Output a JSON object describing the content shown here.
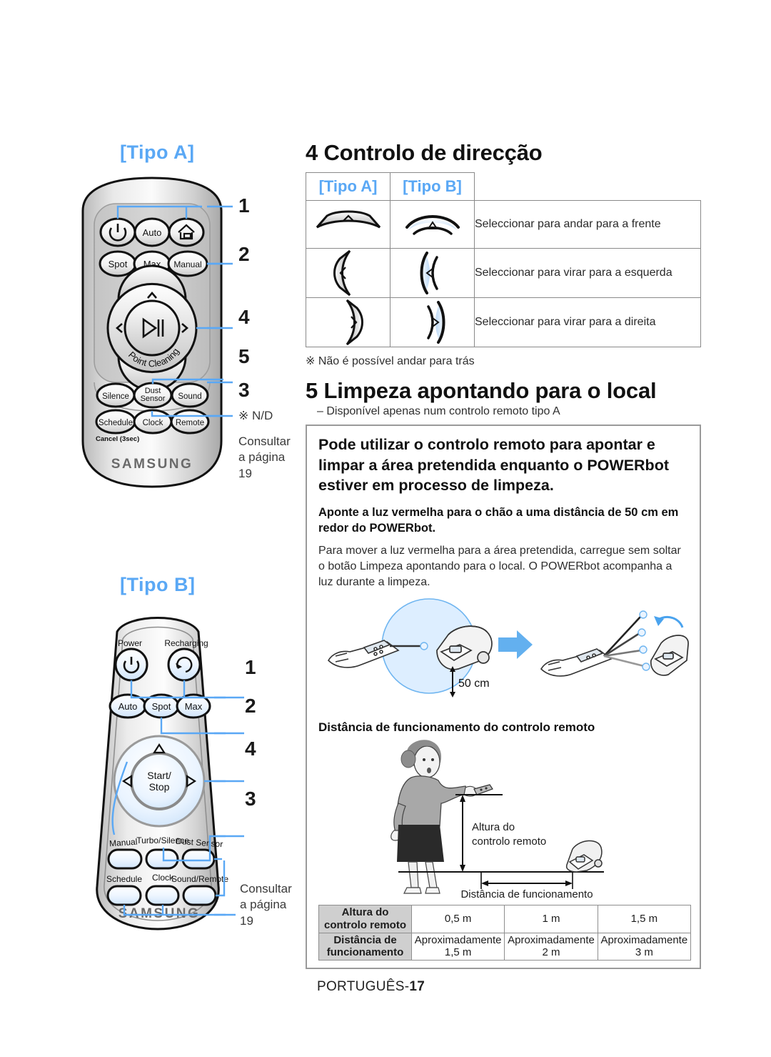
{
  "page": {
    "footer_label": "PORTUGUÊS-",
    "footer_number": "17"
  },
  "left": {
    "type_a_label": "[Tipo A]",
    "type_b_label": "[Tipo B]",
    "brand": "SAMSUNG",
    "type_a": {
      "callouts": [
        "1",
        "2",
        "4",
        "5",
        "3"
      ],
      "note_nd": "※ N/D",
      "note_page": "Consultar a página 19",
      "buttons": {
        "power_icon": "power-icon",
        "auto": "Auto",
        "home_icon": "home-dock-icon",
        "spot": "Spot",
        "max": "Max",
        "manual": "Manual",
        "up_icon": "chevron-up-icon",
        "left_icon": "chevron-left-icon",
        "right_icon": "chevron-right-icon",
        "center_icon": "play-pause-icon",
        "point_cleaning": "Point Cleaning",
        "silence": "Silence",
        "dust_sensor": "Dust Sensor",
        "sound": "Sound",
        "schedule": "Schedule",
        "clock": "Clock",
        "remote": "Remote",
        "cancel_sub": "Cancel (3sec)"
      }
    },
    "type_b": {
      "callouts": [
        "1",
        "2",
        "4",
        "3"
      ],
      "note_page": "Consultar a página 19",
      "buttons": {
        "power_label": "Power",
        "recharging_label": "Recharging",
        "power_icon": "power-icon",
        "recharging_icon": "recharge-icon",
        "auto": "Auto",
        "spot": "Spot",
        "max": "Max",
        "up_icon": "triangle-up-icon",
        "left_icon": "triangle-left-icon",
        "right_icon": "triangle-right-icon",
        "start_stop": "Start/\nStop",
        "start_stop_line1": "Start/",
        "start_stop_line2": "Stop",
        "manual": "Manual",
        "turbo_silence": "Turbo/Silence",
        "dust_sensor": "Dust Sensor",
        "schedule": "Schedule",
        "clock": "Clock",
        "sound_remote": "Sound/Remote"
      }
    }
  },
  "right": {
    "section4": {
      "heading": "4 Controlo de direcção",
      "table": {
        "headers": [
          "[Tipo A]",
          "[Tipo B]",
          ""
        ],
        "rows": [
          {
            "icon_a": "arc-up-icon",
            "icon_b": "arc-up-blue-icon",
            "description": "Seleccionar para andar para a frente"
          },
          {
            "icon_a": "arc-left-icon",
            "icon_b": "arc-left-blue-icon",
            "description": "Seleccionar para virar para a esquerda"
          },
          {
            "icon_a": "arc-right-icon",
            "icon_b": "arc-right-blue-icon",
            "description": "Seleccionar para virar para a direita"
          }
        ]
      },
      "note": "※ Não é possível andar para trás"
    },
    "section5": {
      "heading": "5 Limpeza apontando para o local",
      "subnote": "– Disponível apenas num controlo remoto tipo A",
      "lead": "Pode utilizar o controlo remoto para apontar e limpar a área pretendida enquanto o POWERbot estiver em processo de limpeza.",
      "strong": "Aponte a luz vermelha para o chão a uma distância de 50 cm em redor do POWERbot.",
      "body": "Para mover a luz vermelha para a área pretendida, carregue sem soltar o botão Limpeza apontando para o local. O POWERbot acompanha a luz durante a limpeza.",
      "figure1": {
        "distance_label": "50 cm",
        "arrow_icon": "right-arrow-icon",
        "robot_icon": "robot-vacuum-icon",
        "remote_icon": "hand-holding-remote-icon"
      },
      "figure2_caption": "Distância de funcionamento do controlo remoto",
      "figure2": {
        "height_label_line1": "Altura do",
        "height_label_line2": "controlo remoto",
        "distance_label": "Distância de funcionamento",
        "person_icon": "person-with-remote-icon",
        "robot_icon": "robot-vacuum-icon"
      },
      "dist_table": {
        "row1_header_line1": "Altura do",
        "row1_header_line2": "controlo remoto",
        "row1_values": [
          "0,5 m",
          "1 m",
          "1,5 m"
        ],
        "row2_header_line1": "Distância de",
        "row2_header_line2": "funcionamento",
        "row2_values": [
          "Aproximadamente 1,5 m",
          "Aproximadamente 2 m",
          "Aproximadamente 3 m"
        ],
        "row2_values_split": [
          {
            "l1": "Aproximadamente",
            "l2": "1,5 m"
          },
          {
            "l1": "Aproximadamente",
            "l2": "2 m"
          },
          {
            "l1": "Aproximadamente",
            "l2": "3 m"
          }
        ]
      }
    }
  },
  "colors": {
    "accent_blue": "#5aa8f5",
    "text": "#1a1a1a",
    "table_border": "#8a8a8a",
    "header_fill": "#cfcfcf"
  }
}
